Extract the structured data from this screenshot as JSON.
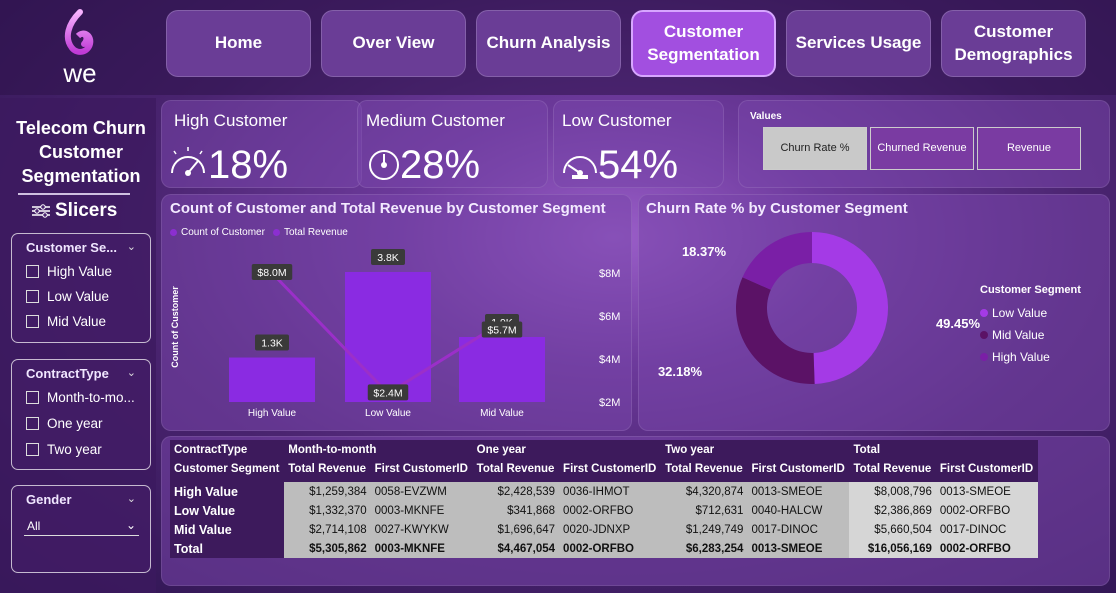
{
  "brand": {
    "logo_text": "we"
  },
  "nav": [
    {
      "label": "Home"
    },
    {
      "label": "Over View"
    },
    {
      "label": "Churn Analysis"
    },
    {
      "label": "Customer Segmentation"
    },
    {
      "label": "Services Usage"
    },
    {
      "label": "Customer Demographics"
    }
  ],
  "sidebar": {
    "title": "Telecom Churn Customer Segmentation",
    "slicers_label": "Slicers",
    "slicer_segment": {
      "header": "Customer Se...",
      "options": [
        "High Value",
        "Low Value",
        "Mid Value"
      ]
    },
    "slicer_contract": {
      "header": "ContractType",
      "options": [
        "Month-to-mo...",
        "One year",
        "Two year"
      ]
    },
    "slicer_gender": {
      "header": "Gender",
      "selected": "All"
    }
  },
  "kpis": [
    {
      "label": "High Customer",
      "value": "18%",
      "icon": "gauge-high-icon"
    },
    {
      "label": "Medium Customer",
      "value": "28%",
      "icon": "gauge-medium-icon"
    },
    {
      "label": "Low Customer",
      "value": "54%",
      "icon": "gauge-low-icon"
    }
  ],
  "values_toggle": {
    "label": "Values",
    "options": [
      "Churn Rate %",
      "Churned Revenue",
      "Revenue"
    ],
    "selected": "Churn Rate %"
  },
  "bar_chart_ui": {
    "title": "Count of Customer and Total Revenue by Customer Segment",
    "legend": [
      "Count of Customer",
      "Total Revenue"
    ],
    "y_label": "Count of Customer",
    "right_ticks": [
      "$8M",
      "$6M",
      "$4M",
      "$2M"
    ]
  },
  "donut_ui": {
    "title": "Churn Rate % by Customer Segment",
    "legend_title": "Customer Segment"
  },
  "chart_data": [
    {
      "type": "bar",
      "title": "Count of Customer and Total Revenue by Customer Segment",
      "categories": [
        "High Value",
        "Low Value",
        "Mid Value"
      ],
      "series": [
        {
          "name": "Count of Customer",
          "values": [
            1300,
            3800,
            1900
          ],
          "labels": [
            "1.3K",
            "3.8K",
            "1.9K"
          ]
        },
        {
          "name": "Total Revenue",
          "values": [
            8.0,
            2.4,
            5.7
          ],
          "labels": [
            "$8.0M",
            "$2.4M",
            "$5.7M"
          ]
        }
      ],
      "ylabel": "Count of Customer",
      "y2lim": [
        2,
        8
      ],
      "colors": {
        "bar": "#8a2be2",
        "line": "#9b2fc9"
      }
    },
    {
      "type": "pie",
      "title": "Churn Rate % by Customer Segment",
      "slices": [
        {
          "name": "Low Value",
          "value": 49.45,
          "label": "49.45%",
          "color": "#a43ae6"
        },
        {
          "name": "Mid Value",
          "value": 32.18,
          "label": "32.18%",
          "color": "#5b1266"
        },
        {
          "name": "High Value",
          "value": 18.37,
          "label": "18.37%",
          "color": "#7a1fa6"
        }
      ]
    }
  ],
  "table": {
    "top_headers": [
      "ContractType",
      "Month-to-month",
      "One year",
      "Two year",
      "Total"
    ],
    "sub_headers": [
      "Customer Segment",
      "Total Revenue",
      "First CustomerID",
      "Total Revenue",
      "First CustomerID",
      "Total Revenue",
      "First CustomerID",
      "Total Revenue",
      "First CustomerID"
    ],
    "rows": [
      [
        "High Value",
        "$1,259,384",
        "0058-EVZWM",
        "$2,428,539",
        "0036-IHMOT",
        "$4,320,874",
        "0013-SMEOE",
        "$8,008,796",
        "0013-SMEOE"
      ],
      [
        "Low Value",
        "$1,332,370",
        "0003-MKNFE",
        "$341,868",
        "0002-ORFBO",
        "$712,631",
        "0040-HALCW",
        "$2,386,869",
        "0002-ORFBO"
      ],
      [
        "Mid Value",
        "$2,714,108",
        "0027-KWYKW",
        "$1,696,647",
        "0020-JDNXP",
        "$1,249,749",
        "0017-DINOC",
        "$5,660,504",
        "0017-DINOC"
      ],
      [
        "Total",
        "$5,305,862",
        "0003-MKNFE",
        "$4,467,054",
        "0002-ORFBO",
        "$6,283,254",
        "0013-SMEOE",
        "$16,056,169",
        "0002-ORFBO"
      ]
    ]
  }
}
